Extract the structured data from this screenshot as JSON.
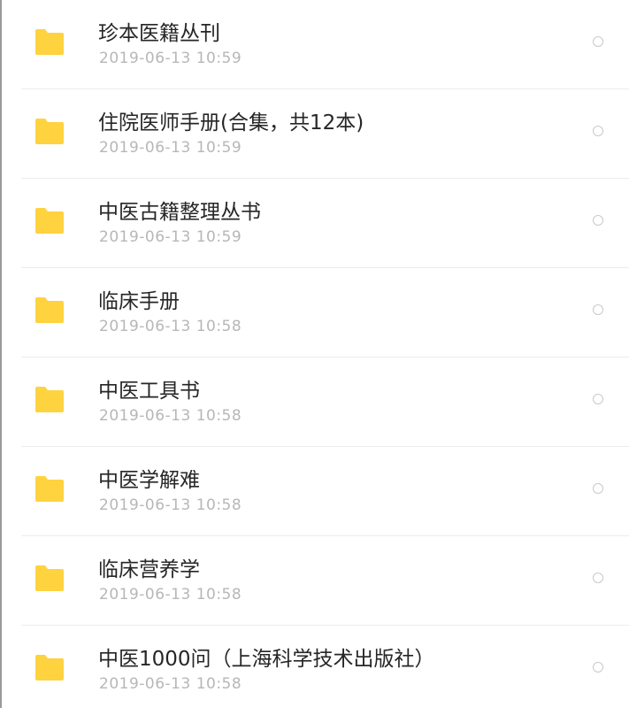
{
  "icons": {
    "folder": "folder-icon",
    "select": "radio-circle"
  },
  "colors": {
    "folder": "#FFD23F",
    "title": "#262626",
    "date": "#B7B7B7"
  },
  "files": [
    {
      "name": "珍本医籍丛刊",
      "modified": "2019-06-13  10:59"
    },
    {
      "name": "住院医师手册(合集，共12本)",
      "modified": "2019-06-13  10:59"
    },
    {
      "name": "中医古籍整理丛书",
      "modified": "2019-06-13  10:59"
    },
    {
      "name": "临床手册",
      "modified": "2019-06-13  10:58"
    },
    {
      "name": "中医工具书",
      "modified": "2019-06-13  10:58"
    },
    {
      "name": "中医学解难",
      "modified": "2019-06-13  10:58"
    },
    {
      "name": "临床营养学",
      "modified": "2019-06-13  10:58"
    },
    {
      "name": "中医1000问（上海科学技术出版社）",
      "modified": "2019-06-13  10:58"
    }
  ]
}
